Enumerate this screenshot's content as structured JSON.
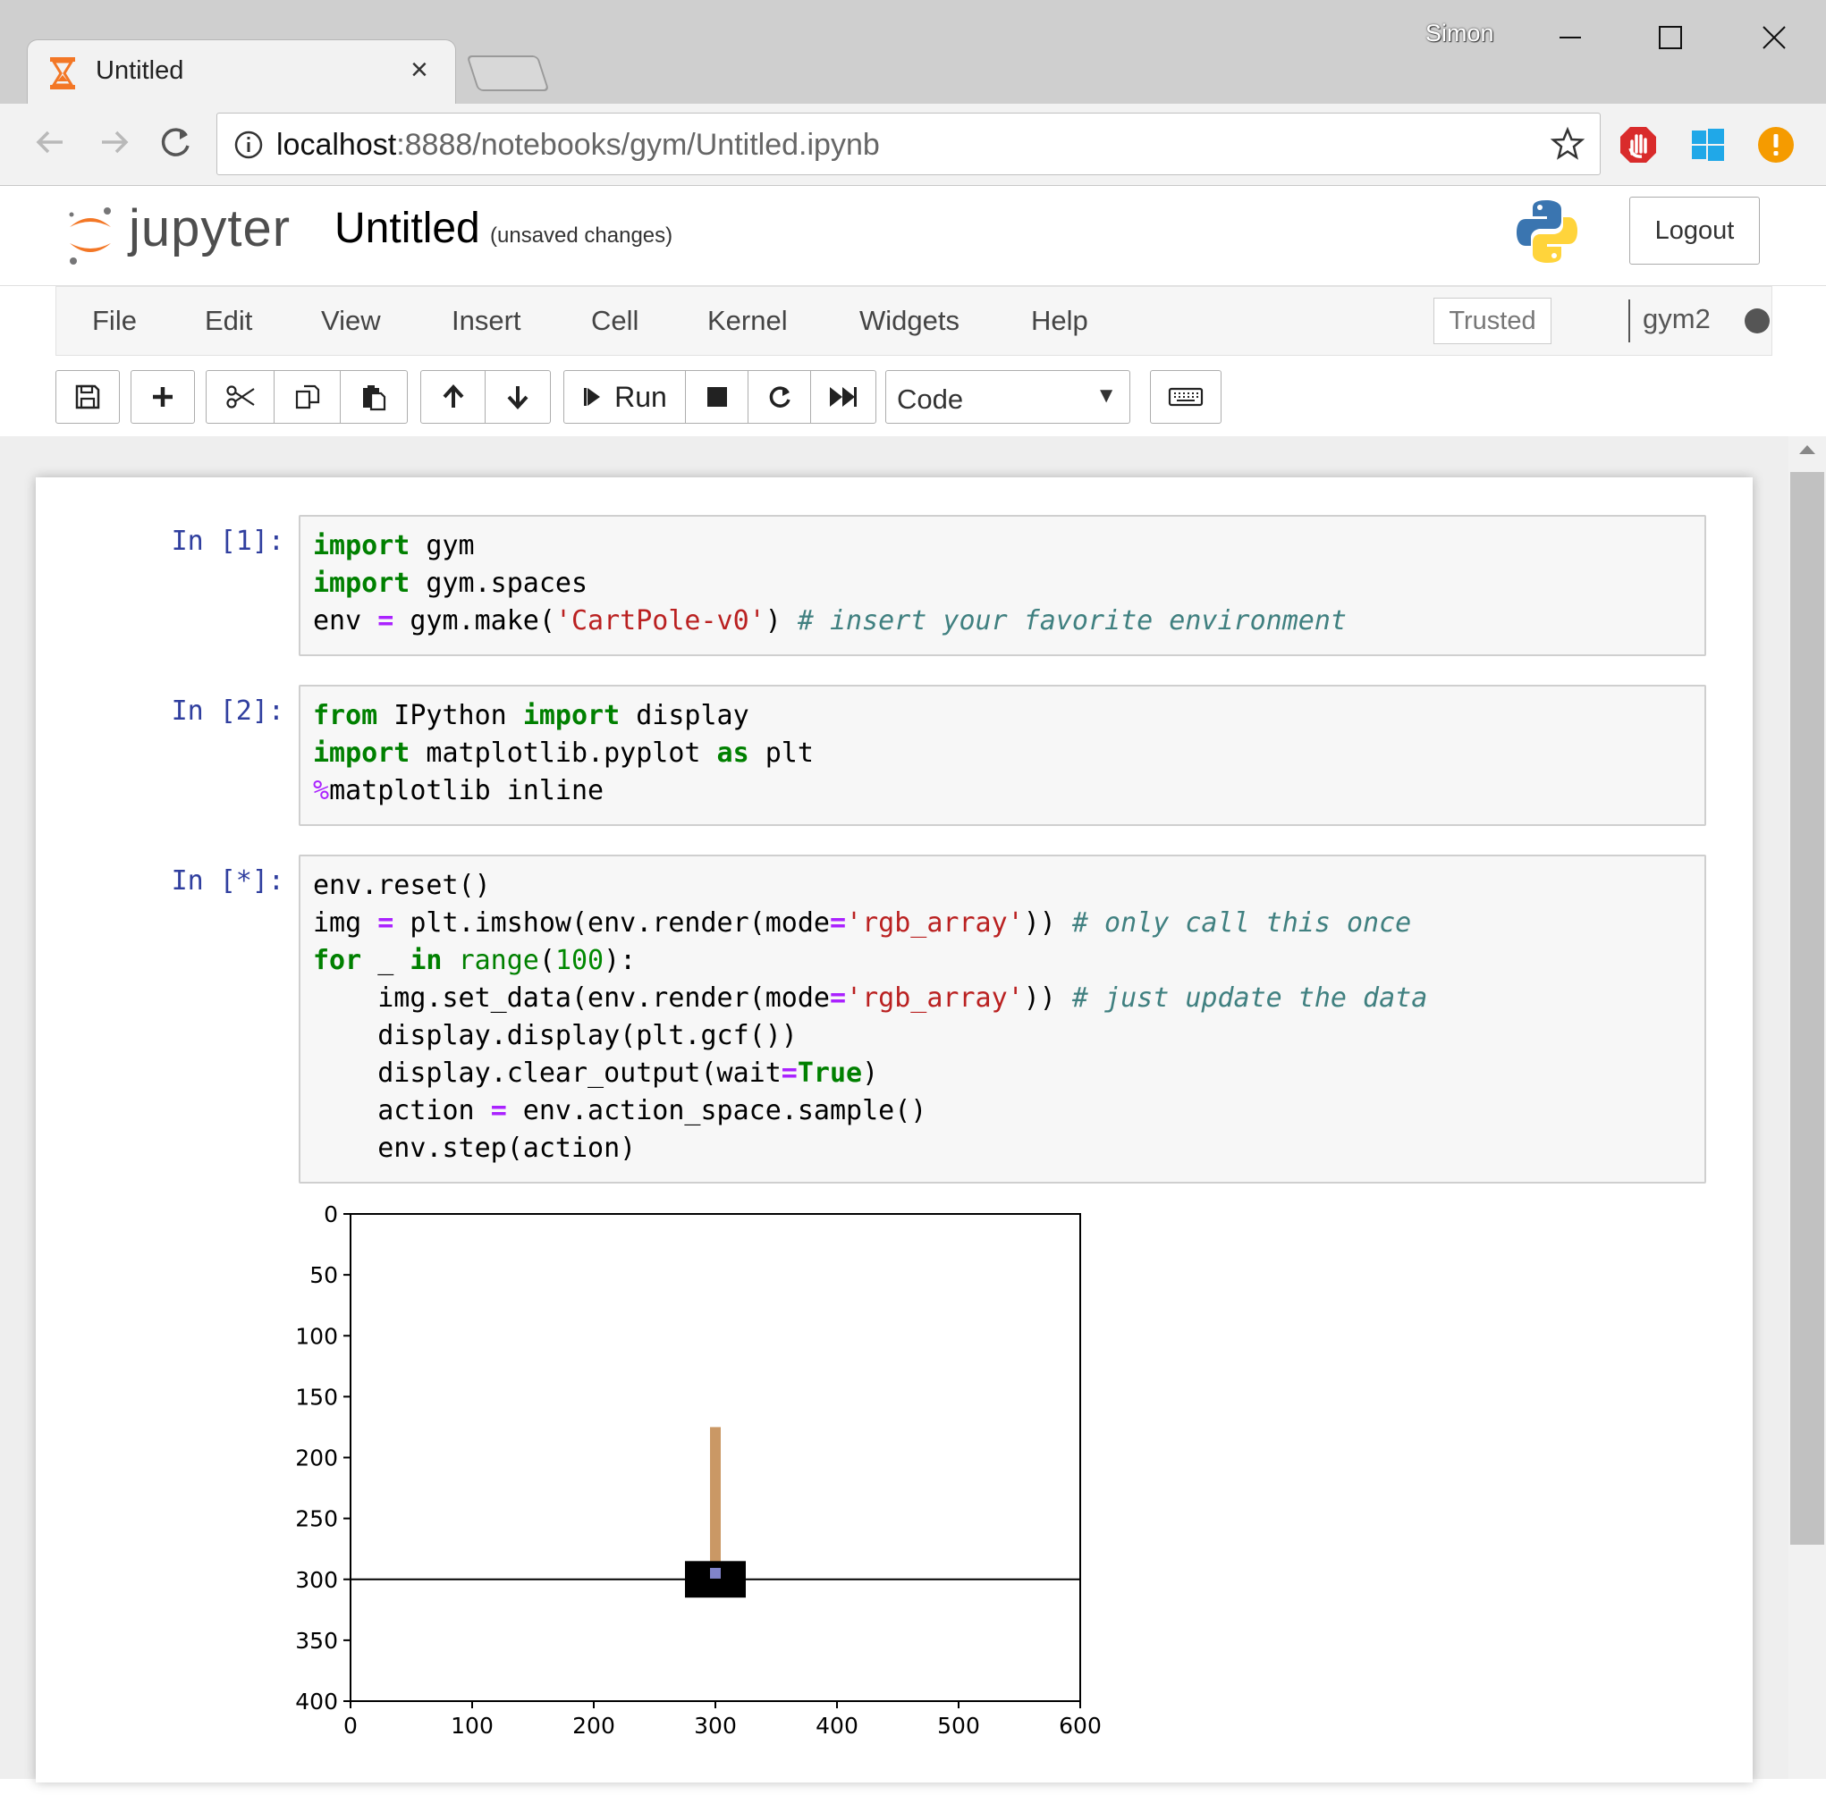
{
  "window": {
    "user": "Simon"
  },
  "tab": {
    "title": "Untitled",
    "close": "×"
  },
  "address": {
    "host": "localhost",
    "rest": ":8888/notebooks/gym/Untitled.ipynb"
  },
  "header": {
    "logo_text": "jupyter",
    "notebook_name": "Untitled",
    "save_status": "(unsaved changes)",
    "logout_label": "Logout"
  },
  "menu": {
    "items": [
      "File",
      "Edit",
      "View",
      "Insert",
      "Cell",
      "Kernel",
      "Widgets",
      "Help"
    ],
    "trusted_label": "Trusted",
    "kernel_name": "gym2"
  },
  "toolbar": {
    "run_label": "Run",
    "cell_type": "Code",
    "cell_type_options": [
      "Code"
    ]
  },
  "cells": [
    {
      "prompt": "In [1]:",
      "lines": [
        "import gym",
        "import gym.spaces",
        "env = gym.make('CartPole-v0') # insert your favorite environment"
      ]
    },
    {
      "prompt": "In [2]:",
      "lines": [
        "from IPython import display",
        "import matplotlib.pyplot as plt",
        "%matplotlib inline"
      ]
    },
    {
      "prompt": "In [*]:",
      "lines": [
        "env.reset()",
        "img = plt.imshow(env.render(mode='rgb_array')) # only call this once",
        "for _ in range(100):",
        "    img.set_data(env.render(mode='rgb_array')) # just update the data",
        "    display.display(plt.gcf())",
        "    display.clear_output(wait=True)",
        "    action = env.action_space.sample()",
        "    env.step(action)"
      ]
    }
  ],
  "output_plot": {
    "type": "image",
    "x_ticks": [
      "0",
      "100",
      "200",
      "300",
      "400",
      "500",
      "600"
    ],
    "y_ticks": [
      "0",
      "50",
      "100",
      "150",
      "200",
      "250",
      "300",
      "350",
      "400"
    ],
    "xlim": [
      0,
      600
    ],
    "ylim": [
      400,
      0
    ],
    "track_y": 300,
    "cart": {
      "x_center": 300,
      "y_center": 300,
      "width": 50,
      "height": 30,
      "color": "#000000"
    },
    "pole": {
      "x": 300,
      "y_top": 175,
      "y_bottom": 295,
      "color": "#ca9865",
      "axle_color": "#8184cb"
    }
  },
  "colors": {
    "prompt": "#303f9f",
    "keyword": "#008000",
    "operator": "#aa22ff",
    "string": "#ba2121",
    "comment": "#408080",
    "jupyter_orange": "#f37726"
  }
}
